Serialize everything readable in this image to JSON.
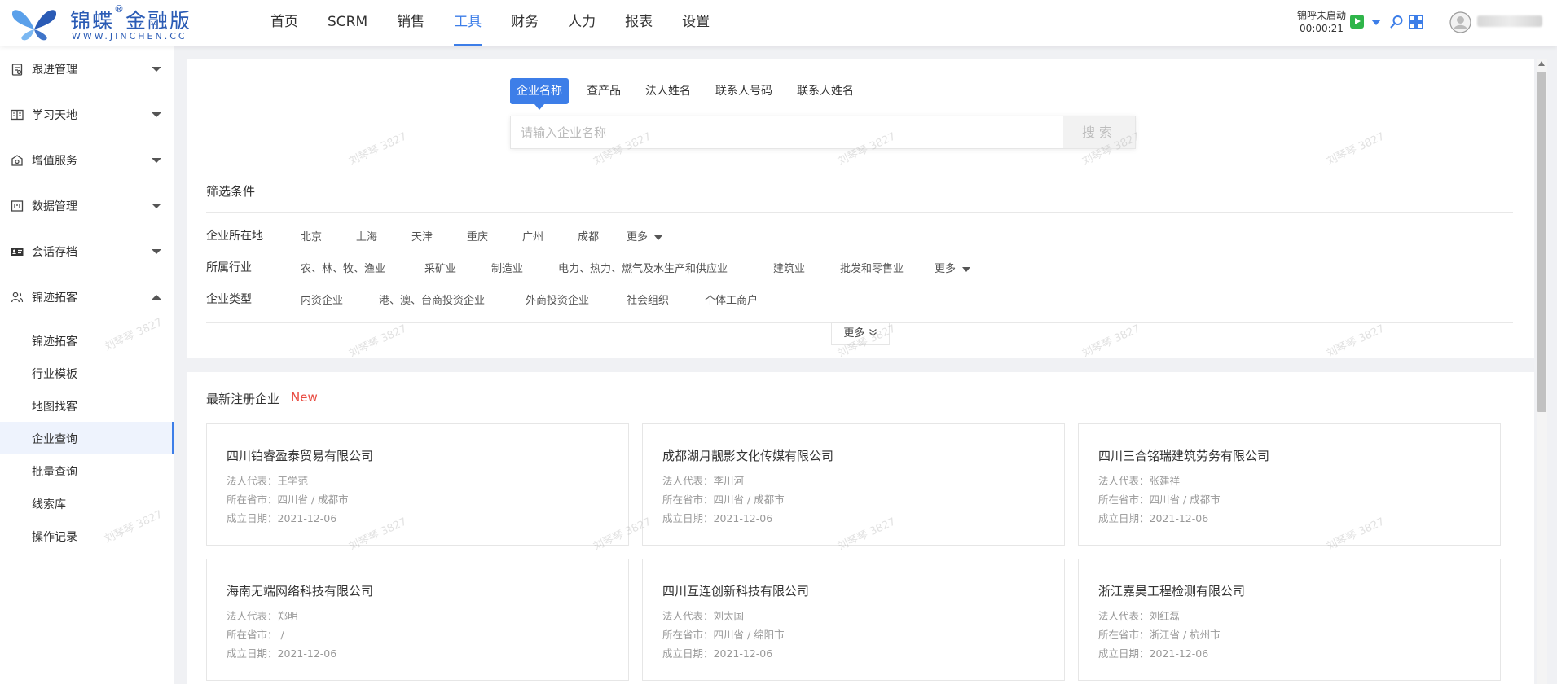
{
  "header": {
    "logo_brand": "锦蝶",
    "logo_edition": "金融版",
    "logo_reg": "®",
    "logo_site": "WWW.JINCHEN.CC",
    "nav": [
      "首页",
      "SCRM",
      "销售",
      "工具",
      "财务",
      "人力",
      "报表",
      "设置"
    ],
    "active_nav": "工具",
    "call_status": "锦呼未启动",
    "call_timer": "00:00:21"
  },
  "sidebar": {
    "groups": [
      {
        "label": "跟进管理",
        "icon": "clipboard-icon"
      },
      {
        "label": "学习天地",
        "icon": "book-icon"
      },
      {
        "label": "增值服务",
        "icon": "shop-icon"
      },
      {
        "label": "数据管理",
        "icon": "database-icon"
      },
      {
        "label": "会话存档",
        "icon": "id-card-icon"
      },
      {
        "label": "锦迹拓客",
        "icon": "people-icon"
      }
    ],
    "subitems": [
      "锦迹拓客",
      "行业模板",
      "地图找客",
      "企业查询",
      "批量查询",
      "线索库",
      "操作记录"
    ],
    "active_sub": "企业查询"
  },
  "search": {
    "tabs": [
      "企业名称",
      "查产品",
      "法人姓名",
      "联系人号码",
      "联系人姓名"
    ],
    "active_tab": "企业名称",
    "placeholder": "请输入企业名称",
    "button": "搜索"
  },
  "filters": {
    "title": "筛选条件",
    "location_label": "企业所在地",
    "locations": [
      "北京",
      "上海",
      "天津",
      "重庆",
      "广州",
      "成都"
    ],
    "industry_label": "所属行业",
    "industries": [
      "农、林、牧、渔业",
      "采矿业",
      "制造业",
      "电力、热力、燃气及水生产和供应业",
      "建筑业",
      "批发和零售业"
    ],
    "type_label": "企业类型",
    "types": [
      "内资企业",
      "港、澳、台商投资企业",
      "外商投资企业",
      "社会组织",
      "个体工商户"
    ],
    "more": "更多",
    "expand": "更多"
  },
  "latest": {
    "title": "最新注册企业",
    "badge": "New",
    "rep_label": "法人代表：",
    "loc_label": "所在省市：",
    "date_label": "成立日期：",
    "companies": [
      {
        "name": "四川铂睿盈泰贸易有限公司",
        "rep": "王学范",
        "loc": "四川省 / 成都市",
        "date": "2021-12-06"
      },
      {
        "name": "成都湖月靓影文化传媒有限公司",
        "rep": "李川河",
        "loc": "四川省 / 成都市",
        "date": "2021-12-06"
      },
      {
        "name": "四川三合铭瑞建筑劳务有限公司",
        "rep": "张建祥",
        "loc": "四川省 / 成都市",
        "date": "2021-12-06"
      },
      {
        "name": "海南无端网络科技有限公司",
        "rep": "郑明",
        "loc": " /",
        "date": "2021-12-06"
      },
      {
        "name": "四川互连创新科技有限公司",
        "rep": "刘太国",
        "loc": "四川省 / 绵阳市",
        "date": "2021-12-06"
      },
      {
        "name": "浙江嘉昊工程检测有限公司",
        "rep": "刘红磊",
        "loc": "浙江省 / 杭州市",
        "date": "2021-12-06"
      }
    ]
  },
  "watermark": "刘琴琴 3827",
  "colors": {
    "accent": "#3d7ee8",
    "badge": "#e8483e",
    "brand": "#2a5bb5",
    "call_green": "#2fb54a"
  }
}
